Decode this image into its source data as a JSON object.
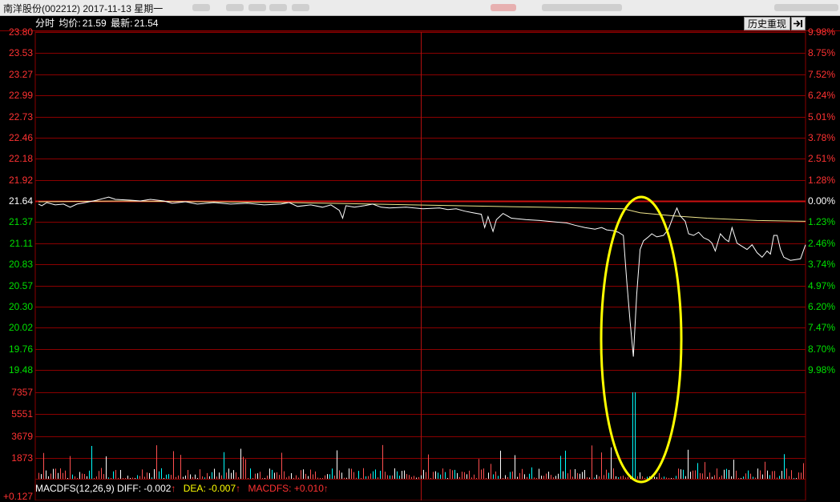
{
  "window": {
    "title": "南洋股份(002212) 2017-11-13 星期一"
  },
  "info_bar": {
    "mode": "分时",
    "avg_label": "均价:",
    "avg_value": "21.59",
    "latest_label": "最新:",
    "latest_value": "21.54"
  },
  "buttons": {
    "history_replay": "历史重现"
  },
  "price_axis_left": [
    "23.80",
    "23.53",
    "23.27",
    "22.99",
    "22.73",
    "22.46",
    "22.18",
    "21.92",
    "21.64",
    "21.37",
    "21.11",
    "20.83",
    "20.57",
    "20.30",
    "20.02",
    "19.76",
    "19.48"
  ],
  "pct_axis_right": [
    "9.98%",
    "8.75%",
    "7.52%",
    "6.24%",
    "5.01%",
    "3.78%",
    "2.51%",
    "1.28%",
    "0.00%",
    "1.23%",
    "2.46%",
    "3.74%",
    "4.97%",
    "6.20%",
    "7.47%",
    "8.70%",
    "9.98%"
  ],
  "volume_axis": [
    "7357",
    "5551",
    "3679",
    "1873"
  ],
  "macd_axis_bottom": "+0.127",
  "macd_bar": {
    "name": "MACDFS(12,26,9)",
    "diff_label": "DIFF:",
    "diff_value": "-0.002",
    "dea_label": "DEA:",
    "dea_value": "-0.007",
    "macdfs_label": "MACDFS:",
    "macdfs_value": "+0.010"
  },
  "colors": {
    "grid": "#8b0000",
    "up": "#ff3232",
    "down": "#00e000",
    "price_line": "#ffffff",
    "avg_line": "#f0e68c",
    "volume": "#00ffff",
    "highlight": "#ffff00"
  },
  "chart_data": {
    "type": "line",
    "prev_close": 21.64,
    "ylim": [
      19.48,
      23.8
    ],
    "price_keypoints": [
      [
        0,
        21.6
      ],
      [
        4,
        21.58
      ],
      [
        10,
        21.62
      ],
      [
        20,
        21.59
      ],
      [
        30,
        21.6
      ],
      [
        38,
        21.56
      ],
      [
        46,
        21.6
      ],
      [
        56,
        21.62
      ],
      [
        70,
        21.65
      ],
      [
        84,
        21.69
      ],
      [
        92,
        21.66
      ],
      [
        110,
        21.65
      ],
      [
        122,
        21.64
      ],
      [
        134,
        21.66
      ],
      [
        150,
        21.64
      ],
      [
        160,
        21.61
      ],
      [
        176,
        21.63
      ],
      [
        190,
        21.6
      ],
      [
        210,
        21.62
      ],
      [
        230,
        21.6
      ],
      [
        250,
        21.61
      ],
      [
        270,
        21.59
      ],
      [
        290,
        21.6
      ],
      [
        300,
        21.62
      ],
      [
        310,
        21.57
      ],
      [
        326,
        21.59
      ],
      [
        340,
        21.56
      ],
      [
        350,
        21.59
      ],
      [
        360,
        21.52
      ],
      [
        364,
        21.42
      ],
      [
        368,
        21.58
      ],
      [
        378,
        21.56
      ],
      [
        390,
        21.58
      ],
      [
        400,
        21.6
      ],
      [
        410,
        21.56
      ],
      [
        420,
        21.55
      ],
      [
        440,
        21.56
      ],
      [
        460,
        21.54
      ],
      [
        480,
        21.55
      ],
      [
        490,
        21.53
      ],
      [
        500,
        21.54
      ],
      [
        510,
        21.51
      ],
      [
        520,
        21.49
      ],
      [
        530,
        21.47
      ],
      [
        534,
        21.3
      ],
      [
        538,
        21.44
      ],
      [
        544,
        21.25
      ],
      [
        548,
        21.4
      ],
      [
        556,
        21.48
      ],
      [
        566,
        21.42
      ],
      [
        584,
        21.4
      ],
      [
        600,
        21.39
      ],
      [
        620,
        21.37
      ],
      [
        632,
        21.36
      ],
      [
        642,
        21.33
      ],
      [
        654,
        21.3
      ],
      [
        666,
        21.28
      ],
      [
        674,
        21.3
      ],
      [
        680,
        21.27
      ],
      [
        688,
        21.26
      ],
      [
        694,
        21.24
      ],
      [
        700,
        21.2
      ],
      [
        704,
        20.62
      ],
      [
        708,
        20.1
      ],
      [
        712,
        19.65
      ],
      [
        716,
        20.45
      ],
      [
        720,
        21.02
      ],
      [
        724,
        21.13
      ],
      [
        730,
        21.18
      ],
      [
        734,
        21.22
      ],
      [
        740,
        21.18
      ],
      [
        748,
        21.2
      ],
      [
        754,
        21.28
      ],
      [
        760,
        21.45
      ],
      [
        764,
        21.55
      ],
      [
        768,
        21.45
      ],
      [
        774,
        21.38
      ],
      [
        778,
        21.22
      ],
      [
        784,
        21.2
      ],
      [
        790,
        21.24
      ],
      [
        796,
        21.17
      ],
      [
        802,
        21.14
      ],
      [
        806,
        21.1
      ],
      [
        810,
        21.0
      ],
      [
        816,
        21.22
      ],
      [
        822,
        21.15
      ],
      [
        826,
        21.12
      ],
      [
        830,
        21.3
      ],
      [
        836,
        21.1
      ],
      [
        842,
        21.06
      ],
      [
        848,
        21.02
      ],
      [
        854,
        21.08
      ],
      [
        860,
        20.98
      ],
      [
        866,
        20.92
      ],
      [
        872,
        21.0
      ],
      [
        876,
        20.96
      ],
      [
        880,
        21.2
      ],
      [
        884,
        21.2
      ],
      [
        888,
        21.02
      ],
      [
        892,
        20.92
      ],
      [
        900,
        20.88
      ],
      [
        912,
        20.9
      ],
      [
        918,
        21.08
      ]
    ],
    "avg_keypoints": [
      [
        0,
        21.63
      ],
      [
        100,
        21.64
      ],
      [
        200,
        21.63
      ],
      [
        300,
        21.62
      ],
      [
        400,
        21.6
      ],
      [
        500,
        21.58
      ],
      [
        600,
        21.56
      ],
      [
        700,
        21.54
      ],
      [
        720,
        21.49
      ],
      [
        760,
        21.45
      ],
      [
        800,
        21.42
      ],
      [
        860,
        21.39
      ],
      [
        918,
        21.38
      ]
    ],
    "volume_spike": {
      "index": 712,
      "value": 7357
    }
  }
}
